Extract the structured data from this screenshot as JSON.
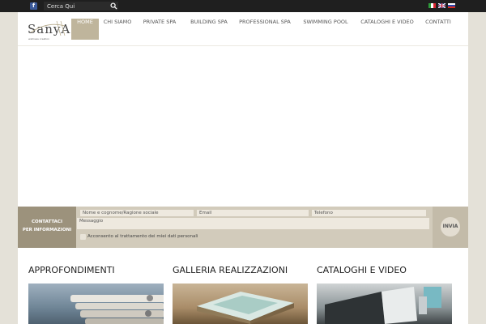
{
  "topbar": {
    "search_placeholder": "Cerca Qui"
  },
  "icons": {
    "facebook": "facebook-icon",
    "search": "search-icon",
    "flags": [
      "flag-italy-icon",
      "flag-uk-icon",
      "flag-russia-icon"
    ]
  },
  "logo": {
    "text": "SanyA",
    "tagline": "wellness creation"
  },
  "nav": {
    "items": [
      {
        "label": "HOME",
        "active": true
      },
      {
        "label": "CHI SIAMO"
      },
      {
        "label": "PRIVATE SPA"
      },
      {
        "label": "BUILDING SPA"
      },
      {
        "label": "PROFESSIONAL SPA"
      },
      {
        "label": "SWIMMING POOL"
      },
      {
        "label": "CATALOGHI E VIDEO"
      },
      {
        "label": "CONTATTI"
      }
    ]
  },
  "contact_form": {
    "label_line1": "CONTATTACI",
    "label_line2": "PER INFORMAZIONI",
    "name_placeholder": "Nome e cognome/Ragione sociale",
    "email_placeholder": "Email",
    "phone_placeholder": "Telefono",
    "message_placeholder": "Messaggio",
    "privacy_label": "Acconsento al trattamento dei miei dati personali",
    "send_label": "INVIA"
  },
  "sections": [
    {
      "title": "APPROFONDIMENTI"
    },
    {
      "title": "GALLERIA REALIZZAZIONI"
    },
    {
      "title": "CATALOGHI E VIDEO"
    }
  ],
  "colors": {
    "accent": "#bfb59c",
    "contact_bar": "#d2cbbb",
    "topbar": "#1f1f1f"
  }
}
